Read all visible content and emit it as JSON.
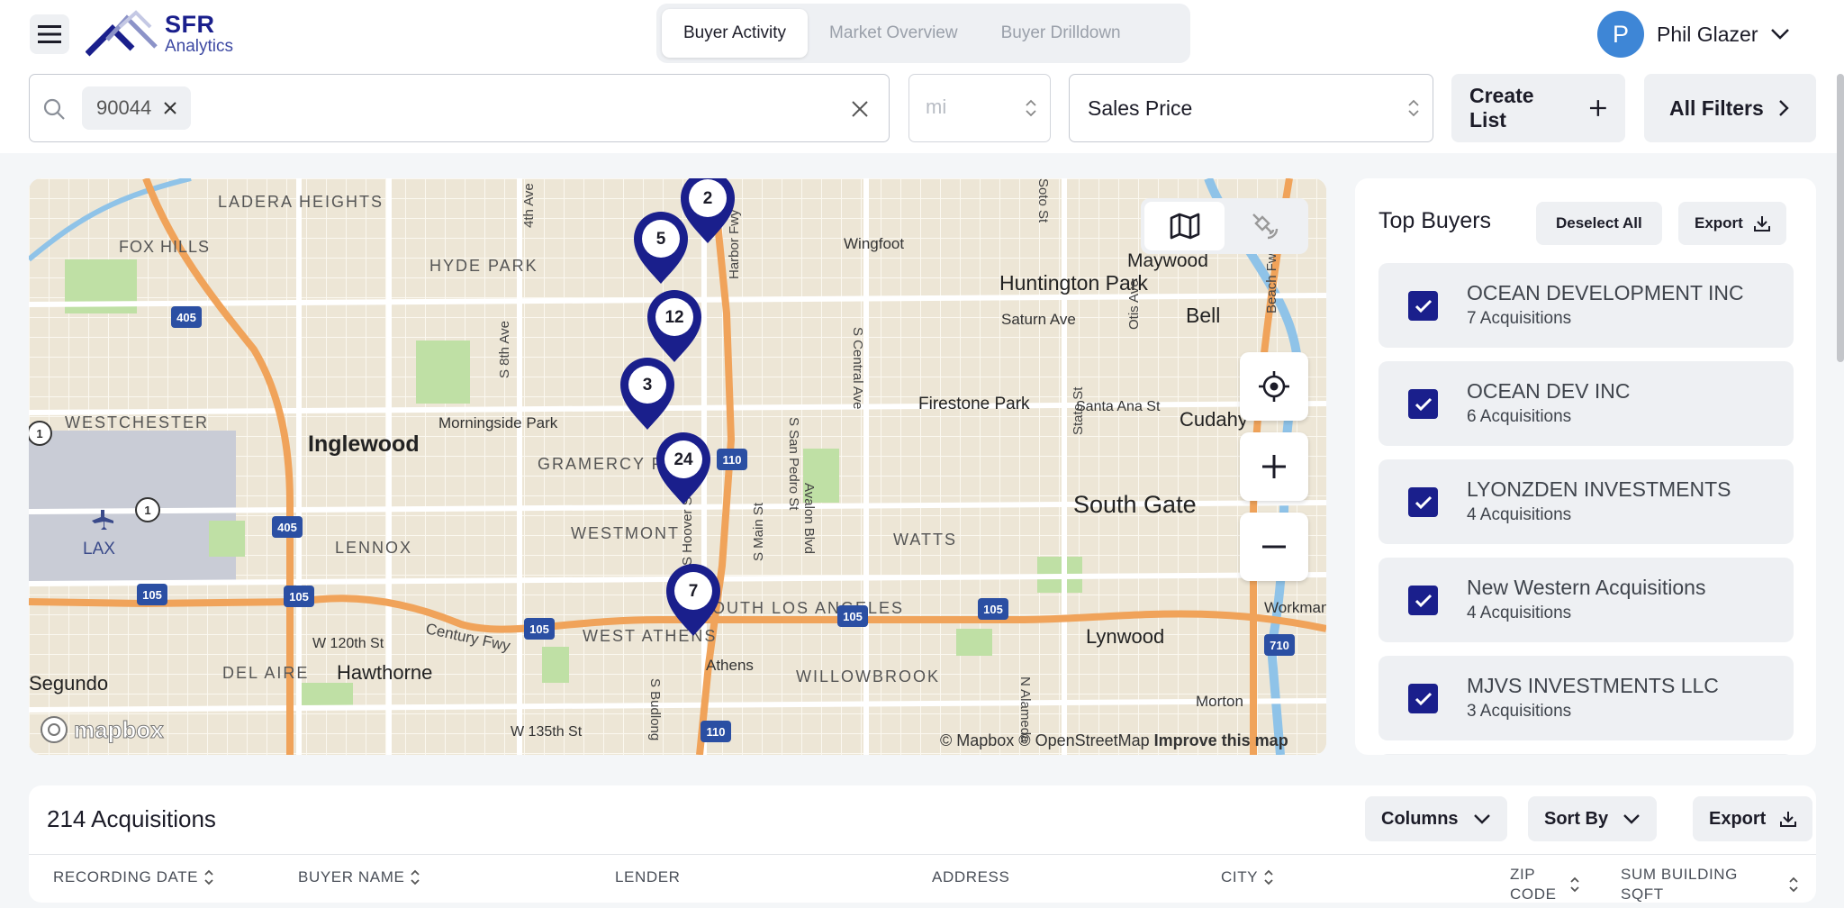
{
  "header": {
    "brand_name": "SFR",
    "brand_sub": "Analytics",
    "tabs": [
      {
        "label": "Buyer Activity",
        "active": true
      },
      {
        "label": "Market Overview",
        "active": false
      },
      {
        "label": "Buyer Drilldown",
        "active": false
      }
    ],
    "user": {
      "initial": "P",
      "name": "Phil Glazer"
    }
  },
  "filters": {
    "search_chip": "90044",
    "unit_placeholder": "mi",
    "sort_select": "Sales Price",
    "create_list_label": "Create List",
    "all_filters_label": "All Filters"
  },
  "map": {
    "place_labels": [
      "LADERA HEIGHTS",
      "FOX HILLS",
      "HYDE PARK",
      "WESTCHESTER",
      "Inglewood",
      "Morningside Park",
      "GRAMERCY PARK",
      "LENNOX",
      "WESTMONT",
      "LAX",
      "W 120th St",
      "DEL AIRE",
      "Hawthorne",
      "WEST ATHENS",
      "Athens",
      "SOUTH LOS ANGELES",
      "WILLOWBROOK",
      "W 135th St",
      "Segundo",
      "Huntington Park",
      "Maywood",
      "Bell",
      "Saturn Ave",
      "Firestone Park",
      "Cudahy",
      "Santa Ana St",
      "South Gate",
      "WATTS",
      "Lynwood",
      "Workman",
      "Morton",
      "Wingfoot",
      "Century Fwy",
      "4th Ave",
      "S 8th Ave",
      "Harbor Fwy",
      "S San Pedro St",
      "S Central Ave",
      "Avalon Blvd",
      "S Main St",
      "S Hoover St",
      "S Budlong",
      "Otis Ave",
      "State St",
      "N Alameda",
      "Soto St",
      "Beach Fwy"
    ],
    "highway_shields": [
      "405",
      "405",
      "405",
      "105",
      "105",
      "105",
      "105",
      "105",
      "110",
      "110",
      "710",
      "1",
      "1"
    ],
    "markers": [
      {
        "count": "2"
      },
      {
        "count": "5"
      },
      {
        "count": "12"
      },
      {
        "count": "3"
      },
      {
        "count": "24"
      },
      {
        "count": "7"
      }
    ],
    "attribution": "© Mapbox © OpenStreetMap",
    "improve_link": "Improve this map",
    "logo_text": "mapbox"
  },
  "top_buyers": {
    "title": "Top Buyers",
    "deselect_label": "Deselect All",
    "export_label": "Export",
    "buyers": [
      {
        "name": "OCEAN DEVELOPMENT INC",
        "acq": "7 Acquisitions",
        "checked": true
      },
      {
        "name": "OCEAN DEV INC",
        "acq": "6 Acquisitions",
        "checked": true
      },
      {
        "name": "LYONZDEN INVESTMENTS",
        "acq": "4 Acquisitions",
        "checked": true
      },
      {
        "name": "New Western Acquisitions",
        "acq": "4 Acquisitions",
        "checked": true
      },
      {
        "name": "MJVS INVESTMENTS LLC",
        "acq": "3 Acquisitions",
        "checked": true
      }
    ]
  },
  "acquisitions": {
    "title": "214 Acquisitions",
    "columns_label": "Columns",
    "sortby_label": "Sort By",
    "export_label": "Export",
    "headers": [
      "RECORDING DATE",
      "BUYER NAME",
      "LENDER",
      "ADDRESS",
      "CITY",
      "ZIP CODE",
      "SUM BUILDING SQFT"
    ]
  },
  "colors": {
    "brand": "#1a1f8c",
    "avatar": "#3e86d6",
    "highway": "#f0a35a",
    "interstate": "#2b4fa3"
  }
}
